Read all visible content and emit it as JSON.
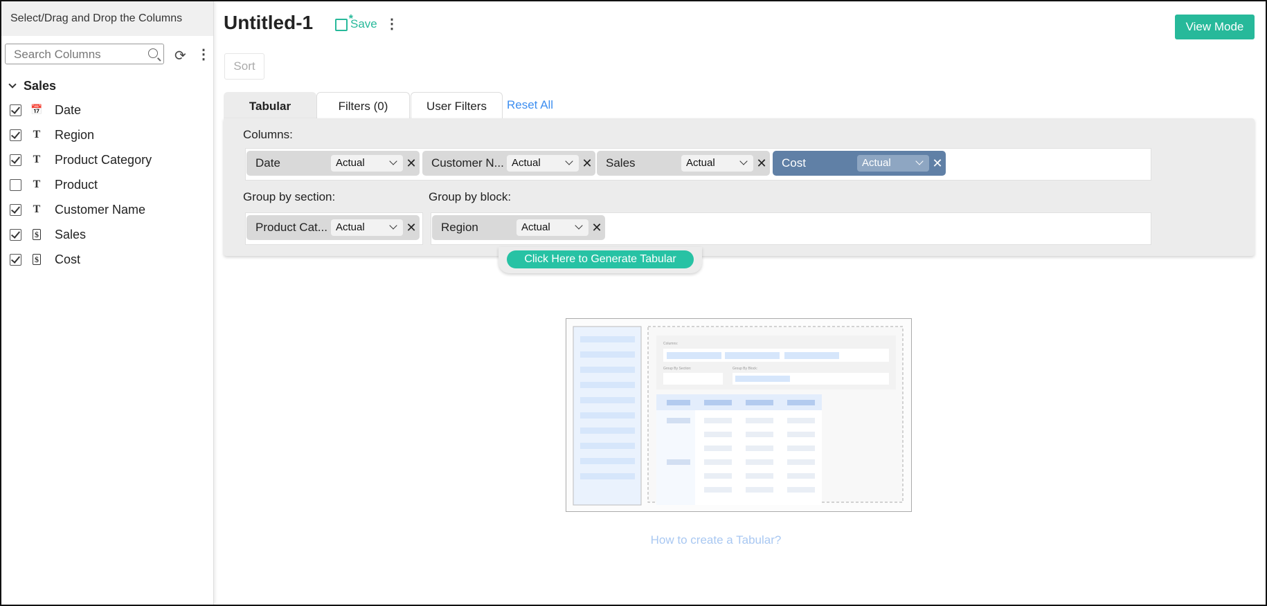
{
  "sidebar": {
    "header": "Select/Drag and Drop the Columns",
    "search_placeholder": "Search Columns",
    "group": "Sales",
    "items": [
      {
        "label": "Date",
        "type": "date",
        "checked": true
      },
      {
        "label": "Region",
        "type": "text",
        "checked": true
      },
      {
        "label": "Product Category",
        "type": "text",
        "checked": true
      },
      {
        "label": "Product",
        "type": "text",
        "checked": false
      },
      {
        "label": "Customer Name",
        "type": "text",
        "checked": true
      },
      {
        "label": "Sales",
        "type": "currency",
        "checked": true
      },
      {
        "label": "Cost",
        "type": "currency",
        "checked": true
      }
    ]
  },
  "header": {
    "title": "Untitled-1",
    "save": "Save",
    "view_mode": "View Mode",
    "sort": "Sort"
  },
  "tabs": [
    "Tabular",
    "Filters  (0)",
    "User Filters"
  ],
  "reset_all": "Reset All",
  "panel": {
    "columns_label": "Columns:",
    "columns": [
      {
        "name": "Date",
        "agg": "Actual"
      },
      {
        "name": "Customer N...",
        "agg": "Actual"
      },
      {
        "name": "Sales",
        "agg": "Actual"
      },
      {
        "name": "Cost",
        "agg": "Actual"
      }
    ],
    "group_section_label": "Group by section:",
    "group_section": [
      {
        "name": "Product Cat...",
        "agg": "Actual"
      }
    ],
    "group_block_label": "Group by block:",
    "group_block": [
      {
        "name": "Region",
        "agg": "Actual"
      }
    ],
    "generate": "Click Here to Generate Tabular"
  },
  "illustration": {
    "columns": "Columns:",
    "group_section": "Group By Section:",
    "group_block": "Group By Block:"
  },
  "help_link": "How to create a Tabular?",
  "colors": {
    "accent": "#27b99a",
    "selected_chip": "#6080a6",
    "link": "#3d8ef0"
  }
}
